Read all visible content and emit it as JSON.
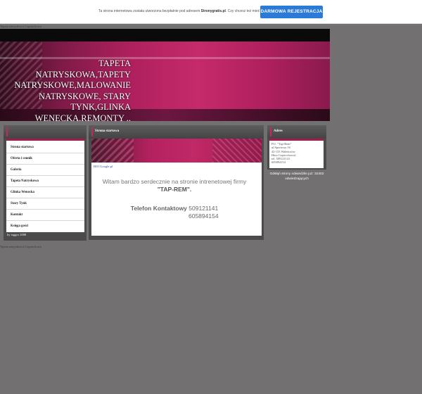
{
  "promo": {
    "text_pre": "Ta strona internetowa została utworzona bezpłatnie pod adresem ",
    "text_brand": "Stronygratis.pl",
    "text_post": ". Czy chcesz też mieć własną stronę?",
    "button": "DARMOWA REJESTRACJA"
  },
  "breadcrumb": "Tapeta natryskowa Częstochowa",
  "header": {
    "title": "TAPETA NATRYSKOWA,TAPETY NATRYSKOWE,MALOWANIE NATRYSKOWE, STARY TYNK,GLINKA WENECKA,REMONTY .."
  },
  "left_menu": {
    "items": [
      {
        "label": "Strona startowa"
      },
      {
        "label": "Oferta i cennik"
      },
      {
        "label": "Galeria"
      },
      {
        "label": "Tapeta Natryskowa"
      },
      {
        "label": "Glinka Wenecka"
      },
      {
        "label": "Stary Tynk"
      },
      {
        "label": "Kontakt"
      },
      {
        "label": "Księga gości"
      }
    ],
    "credit": "by taggro 2008"
  },
  "main": {
    "title": "Strona startowa",
    "fb_link": "BIO Google.pl",
    "welcome_line1": "Witam bardzo serdecznie na stronie intrenetowej firmy",
    "welcome_line2": "\"TAP-REM\".",
    "phone_label": "Telefon Kontaktowy",
    "phone1": "509121141",
    "phone2": "605894154"
  },
  "address": {
    "title": "Adres",
    "lines": [
      "P.U. \"Tap-Rem\"",
      "ul.Sportowa 16",
      "42-133 Waleńczów",
      "Huta Częstochowa)",
      "tel. 509121141",
      "605894154"
    ]
  },
  "visits": "Odsłąń strony odwiedziło już: 32402 odwiedzających",
  "footer_text": "Tapeta natryskowa Częstochowa"
}
